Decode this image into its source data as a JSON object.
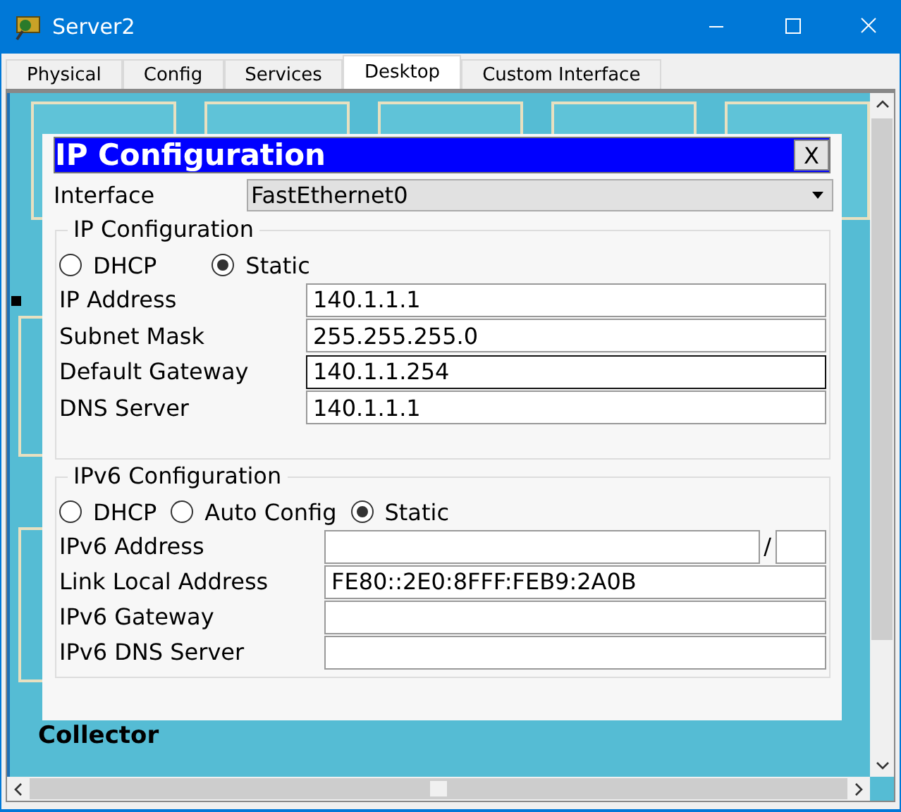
{
  "window": {
    "title": "Server2"
  },
  "tabs": [
    {
      "label": "Physical",
      "selected": false
    },
    {
      "label": "Config",
      "selected": false
    },
    {
      "label": "Services",
      "selected": false
    },
    {
      "label": "Desktop",
      "selected": true
    },
    {
      "label": "Custom Interface",
      "selected": false
    }
  ],
  "desktop": {
    "caption": "Collector"
  },
  "dialog": {
    "title": "IP Configuration",
    "close": "X",
    "interface": {
      "label": "Interface",
      "value": "FastEthernet0"
    },
    "ipv4": {
      "title": "IP Configuration",
      "modes": [
        {
          "label": "DHCP",
          "selected": false
        },
        {
          "label": "Static",
          "selected": true
        }
      ],
      "fields": [
        {
          "label": "IP Address",
          "value": "140.1.1.1",
          "focused": false,
          "kind": "text"
        },
        {
          "label": "Subnet Mask",
          "value": "255.255.255.0",
          "focused": false,
          "kind": "text"
        },
        {
          "label": "Default Gateway",
          "value": "140.1.1.254",
          "focused": true,
          "kind": "text"
        },
        {
          "label": "DNS Server",
          "value": "140.1.1.1",
          "focused": false,
          "kind": "text"
        }
      ]
    },
    "ipv6": {
      "title": "IPv6 Configuration",
      "modes": [
        {
          "label": "DHCP",
          "selected": false
        },
        {
          "label": "Auto Config",
          "selected": false
        },
        {
          "label": "Static",
          "selected": true
        }
      ],
      "fields": [
        {
          "label": "IPv6 Address",
          "focused": false,
          "kind": "prefix",
          "separator": "/"
        },
        {
          "label": "Link Local Address",
          "value": "FE80::2E0:8FFF:FEB9:2A0B",
          "focused": false,
          "kind": "text"
        },
        {
          "label": "IPv6 Gateway",
          "focused": false,
          "kind": "text"
        },
        {
          "label": "IPv6 DNS Server",
          "focused": false,
          "kind": "text"
        }
      ]
    }
  }
}
